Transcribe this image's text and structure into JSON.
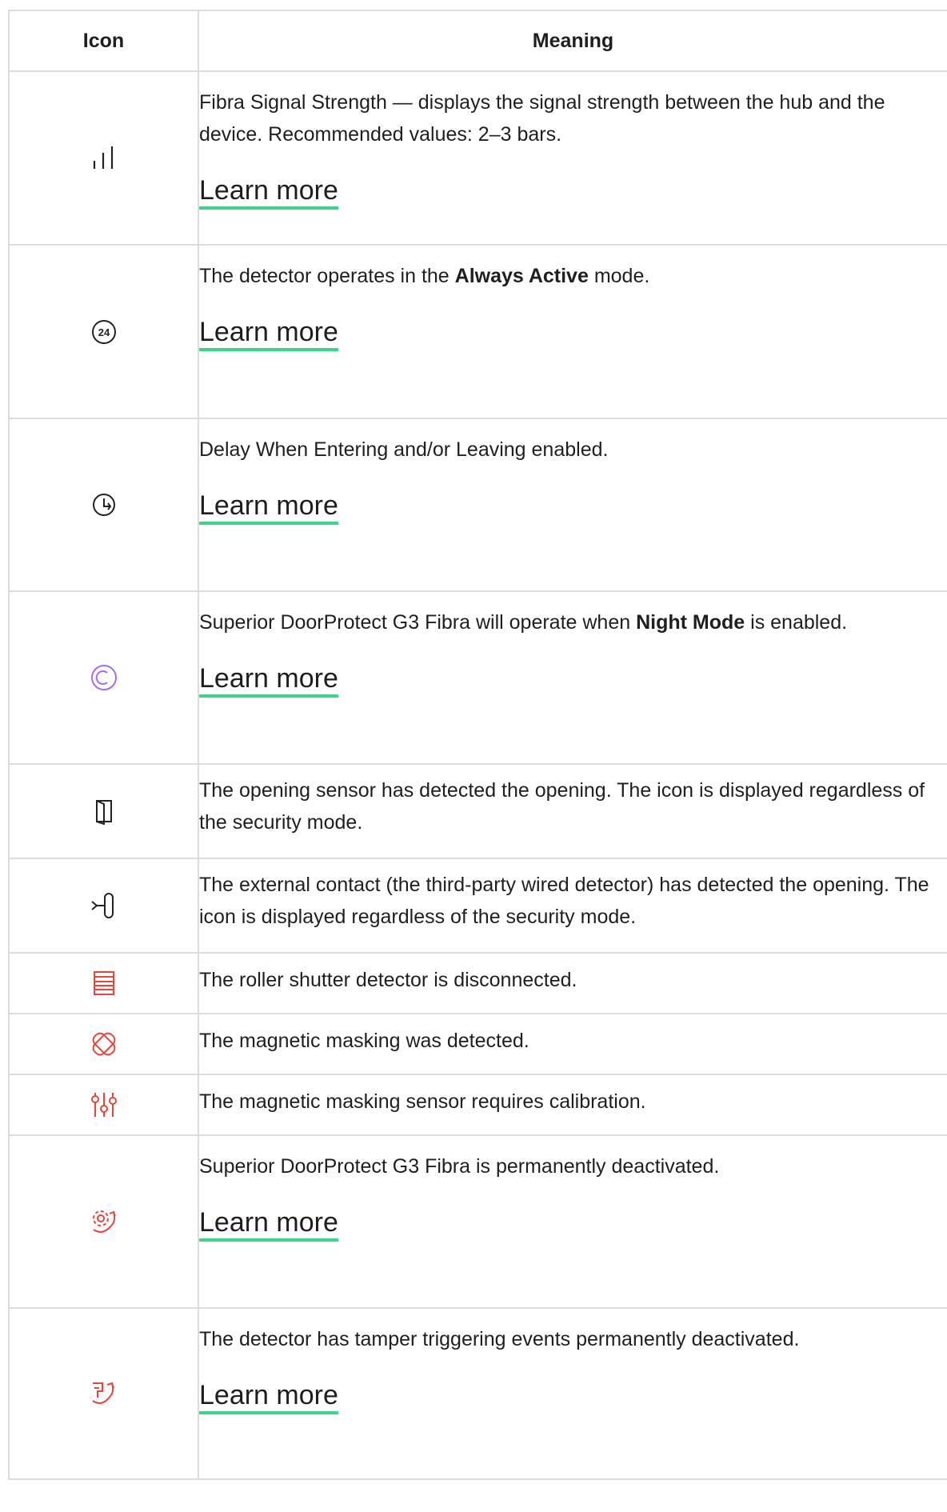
{
  "header": {
    "icon": "Icon",
    "meaning": "Meaning"
  },
  "learn_more": "Learn more",
  "rows": [
    {
      "icon": "signal-strength-icon",
      "text": "Fibra Signal Strength — displays the signal strength between the hub and the device. Recommended values: 2–3 bars.",
      "link": "Learn more"
    },
    {
      "icon": "always-active-24-icon",
      "icon_text": "24",
      "text_before": "The detector operates in the ",
      "text_bold": "Always Active",
      "text_after": " mode.",
      "link": "Learn more"
    },
    {
      "icon": "delay-timer-icon",
      "text": "Delay When Entering and/or Leaving enabled.",
      "link": "Learn more"
    },
    {
      "icon": "night-mode-icon",
      "icon_color": "#a86cf0",
      "text_before": "Superior DoorProtect G3 Fibra will operate when ",
      "text_bold": "Night Mode",
      "text_after": " is enabled.",
      "link": "Learn more"
    },
    {
      "icon": "door-open-icon",
      "text": "The opening sensor has detected the opening. The icon is displayed regardless of the security mode."
    },
    {
      "icon": "external-contact-icon",
      "text": "The external contact (the third-party wired detector) has detected the opening. The icon is displayed regardless of the security mode."
    },
    {
      "icon": "roller-shutter-icon",
      "icon_color": "#e8463a",
      "text": "The roller shutter detector is disconnected."
    },
    {
      "icon": "magnetic-masking-icon",
      "icon_color": "#e8463a",
      "text": "The magnetic masking was detected."
    },
    {
      "icon": "calibration-sliders-icon",
      "icon_color": "#e8463a",
      "text": "The magnetic masking sensor requires calibration."
    },
    {
      "icon": "permanently-deactivated-icon",
      "icon_color": "#e8463a",
      "text": "Superior DoorProtect G3 Fibra is permanently deactivated.",
      "link": "Learn more"
    },
    {
      "icon": "tamper-deactivated-icon",
      "icon_color": "#e8463a",
      "text": "The detector has tamper triggering events permanently deactivated.",
      "link": "Learn more"
    }
  ]
}
